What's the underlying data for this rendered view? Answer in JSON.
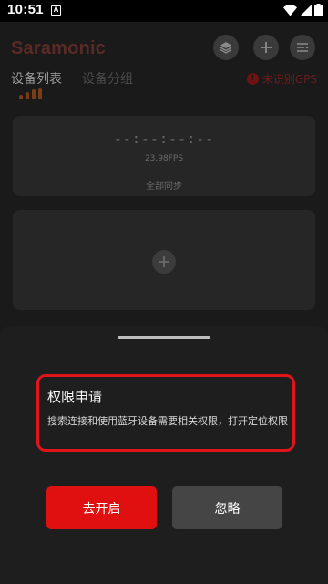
{
  "status_bar": {
    "time": "10:51",
    "notification_icon": "a-icon",
    "icons": [
      "wifi-icon",
      "cellular-icon",
      "battery-icon"
    ]
  },
  "header": {
    "brand": "Saramonic",
    "buttons": [
      "layers-icon",
      "add-icon",
      "menu-list-icon"
    ]
  },
  "tabs": [
    {
      "label": "设备列表",
      "active": true
    },
    {
      "label": "设备分组",
      "active": false
    }
  ],
  "gps_status": "未识别GPS",
  "sync_card": {
    "timecode": "--:--:--:--",
    "fps": "23.98FPS",
    "sync_label": "全部同步"
  },
  "add_device_card": {
    "icon": "add-circle-icon"
  },
  "permission_dialog": {
    "title": "权限申请",
    "description": "搜索连接和使用蓝牙设备需要相关权限，打开定位权限",
    "confirm_label": "去开启",
    "ignore_label": "忽略"
  },
  "colors": {
    "accent_red": "#e01010",
    "highlight_border": "#e0151b",
    "sheet_bg": "#1e1e1e",
    "ignore_button": "#454545"
  }
}
